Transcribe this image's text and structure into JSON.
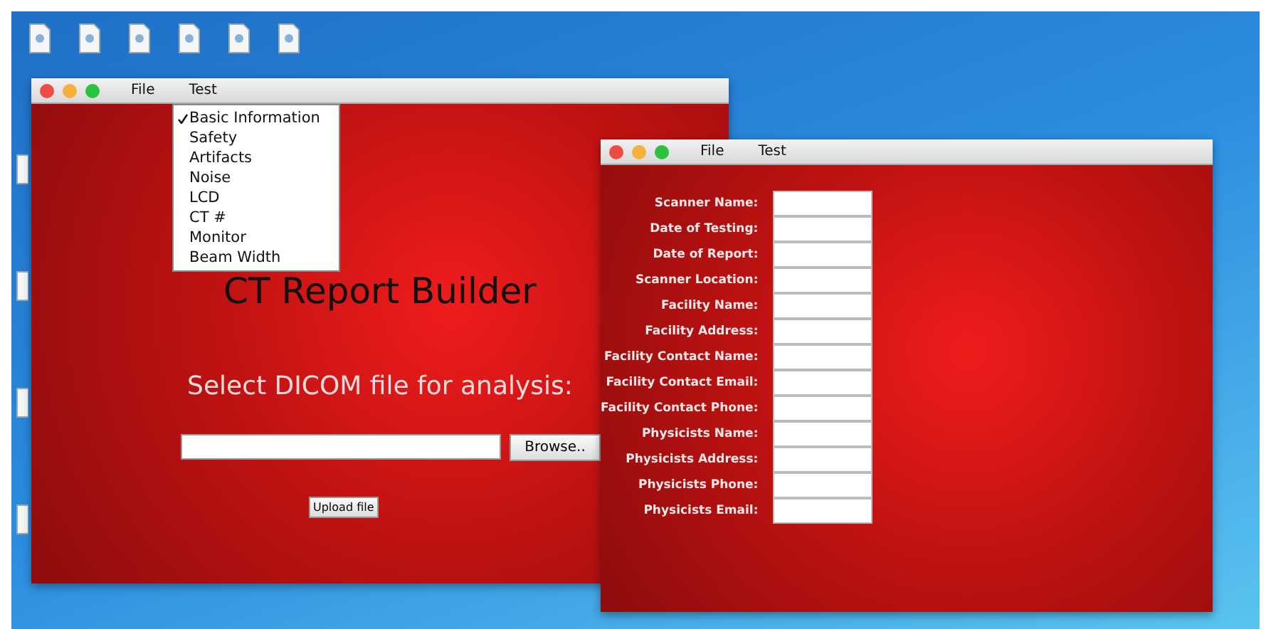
{
  "main_window": {
    "menus": [
      "File",
      "Test"
    ],
    "dropdown": [
      {
        "label": "Basic Information",
        "checked": true
      },
      {
        "label": "Safety",
        "checked": false
      },
      {
        "label": "Artifacts",
        "checked": false
      },
      {
        "label": "Noise",
        "checked": false
      },
      {
        "label": "LCD",
        "checked": false
      },
      {
        "label": "CT #",
        "checked": false
      },
      {
        "label": "Monitor",
        "checked": false
      },
      {
        "label": "Beam Width",
        "checked": false
      }
    ],
    "title": "CT Report Builder",
    "prompt": "Select DICOM file for analysis:",
    "browse_button": "Browse..",
    "upload_button": "Upload file"
  },
  "form_window": {
    "menus": [
      "File",
      "Test"
    ],
    "fields": [
      {
        "label": "Scanner Name:"
      },
      {
        "label": "Date of Testing:"
      },
      {
        "label": "Date of Report:"
      },
      {
        "label": "Scanner Location:"
      },
      {
        "label": "Facility Name:"
      },
      {
        "label": "Facility Address:"
      },
      {
        "label": "Facility Contact Name:"
      },
      {
        "label": "Facility Contact Email:"
      },
      {
        "label": "Facility Contact Phone:"
      },
      {
        "label": "Physicists Name:"
      },
      {
        "label": "Physicists Address:"
      },
      {
        "label": "Physicists Phone:"
      },
      {
        "label": "Physicists Email:"
      }
    ]
  }
}
